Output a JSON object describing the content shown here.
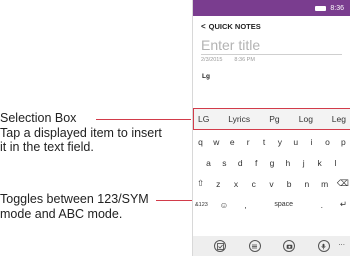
{
  "callouts": {
    "selection_title": "Selection Box",
    "selection_desc": "Tap a displayed item to insert it in the text field.",
    "mode_desc": "Toggles between 123/SYM mode and ABC mode."
  },
  "status_bar": {
    "time": "8:36"
  },
  "app": {
    "back_label": "<",
    "section_title": "QUICK NOTES",
    "title_placeholder": "Enter title",
    "date": "2/3/2015",
    "time": "8:36 PM",
    "body_text": "Lg"
  },
  "suggestions": [
    "LG",
    "Lyrics",
    "Pg",
    "Log",
    "Leg"
  ],
  "keyboard": {
    "row1": [
      "q",
      "w",
      "e",
      "r",
      "t",
      "y",
      "u",
      "i",
      "o",
      "p"
    ],
    "row2": [
      "a",
      "s",
      "d",
      "f",
      "g",
      "h",
      "j",
      "k",
      "l"
    ],
    "row3_shift": "⇧",
    "row3": [
      "z",
      "x",
      "c",
      "v",
      "b",
      "n",
      "m"
    ],
    "row3_backspace": "⌫",
    "row4_mode": "&123",
    "row4_emoji": "☺",
    "row4_comma": ",",
    "row4_space": "space",
    "row4_period": ".",
    "row4_enter": "↵"
  },
  "app_bar": {
    "more": "..."
  }
}
